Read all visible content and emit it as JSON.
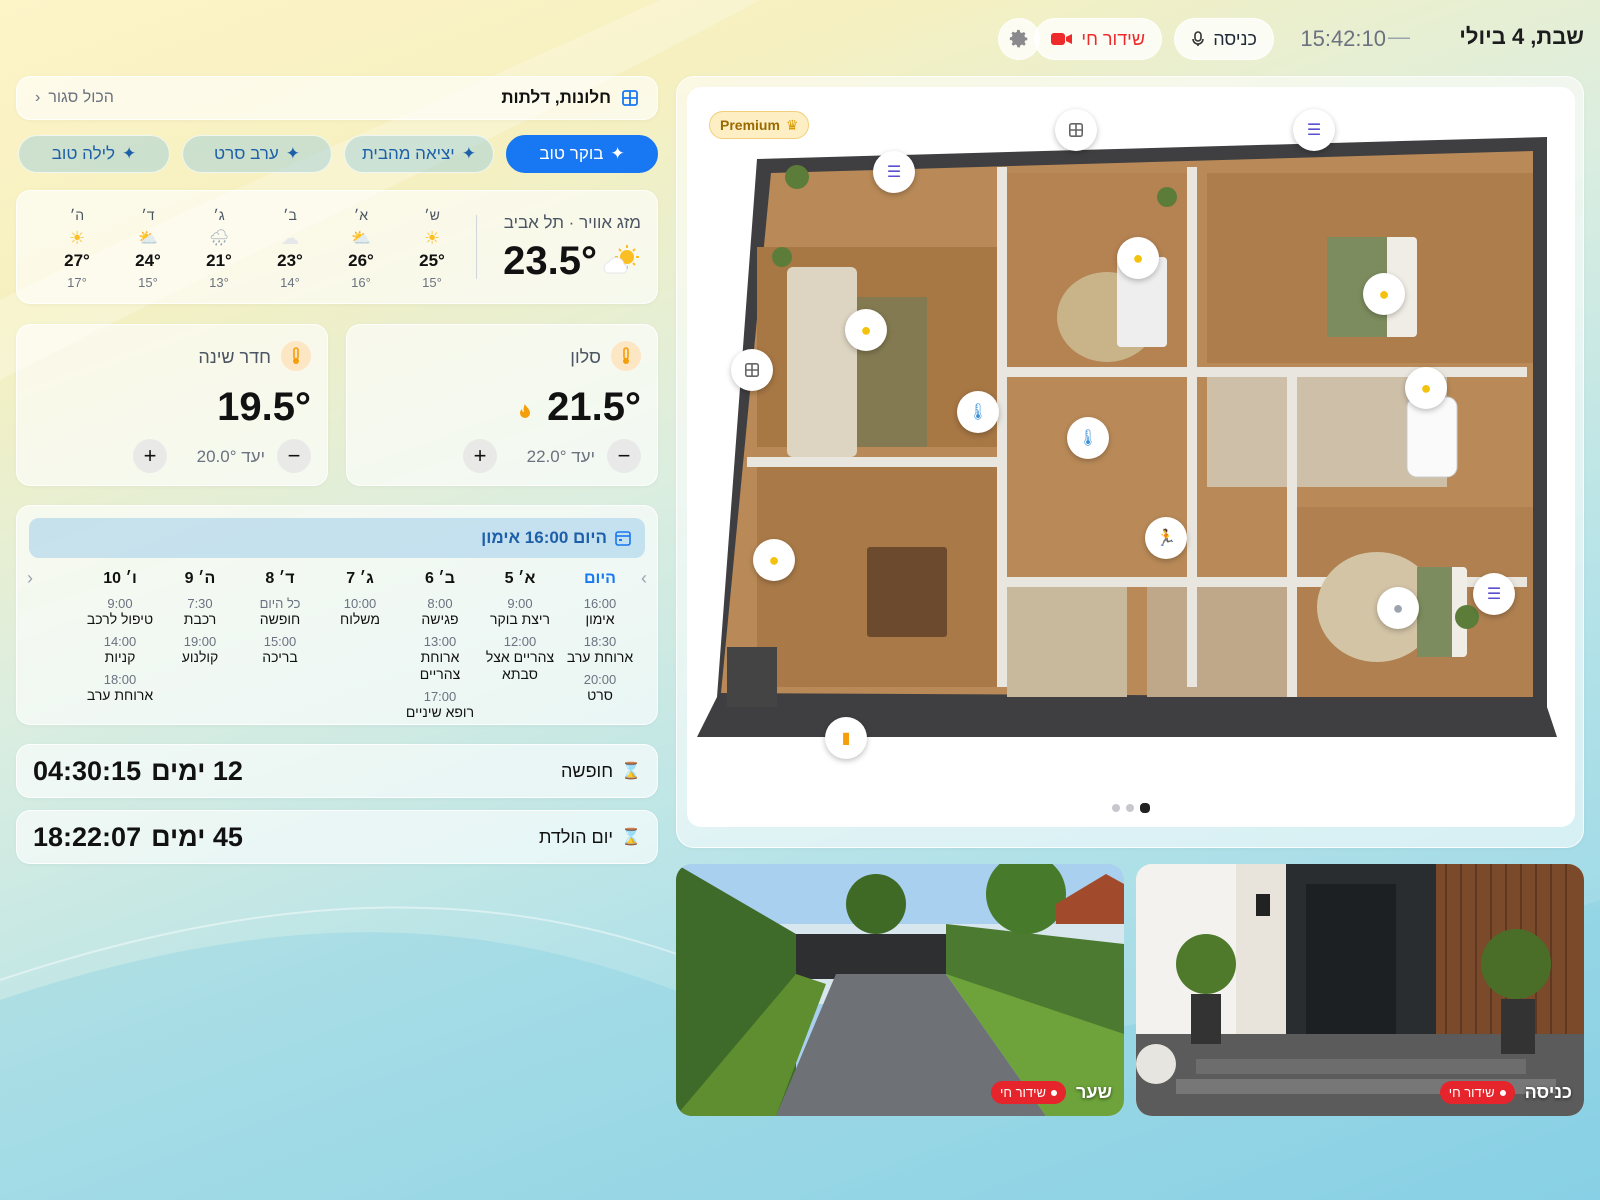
{
  "header": {
    "date": "שבת, 4 ביולי",
    "time": "15:42:10",
    "entrance_label": "כניסה",
    "live_label": "שידור חי"
  },
  "openings": {
    "title": "חלונות, דלתות",
    "status": "הכול סגור"
  },
  "scenes": [
    {
      "label": "בוקר טוב",
      "active": true
    },
    {
      "label": "יציאה מהבית",
      "active": false
    },
    {
      "label": "ערב סרט",
      "active": false
    },
    {
      "label": "לילה טוב",
      "active": false
    }
  ],
  "weather": {
    "title": "מזג אוויר · תל אביב",
    "current": "23.5°",
    "icon": "sun-cloud-icon",
    "forecast": [
      {
        "day": "ש׳",
        "icon": "sun-icon",
        "hi": "25°",
        "lo": "15°"
      },
      {
        "day": "א׳",
        "icon": "sun-cloud-icon",
        "hi": "26°",
        "lo": "16°"
      },
      {
        "day": "ב׳",
        "icon": "cloud-icon",
        "hi": "23°",
        "lo": "14°"
      },
      {
        "day": "ג׳",
        "icon": "rain-icon",
        "hi": "21°",
        "lo": "13°"
      },
      {
        "day": "ד׳",
        "icon": "sun-cloud-icon",
        "hi": "24°",
        "lo": "15°"
      },
      {
        "day": "ה׳",
        "icon": "sun-icon",
        "hi": "27°",
        "lo": "17°"
      }
    ]
  },
  "thermostats": [
    {
      "name": "סלון",
      "temp": "21.5°",
      "target": "יעד 22.0°",
      "heating": true
    },
    {
      "name": "חדר שינה",
      "temp": "19.5°",
      "target": "יעד 20.0°",
      "heating": false
    }
  ],
  "calendar": {
    "header": "היום 16:00 אימון",
    "days": [
      {
        "label": "היום",
        "today": true,
        "events": [
          {
            "time": "16:00",
            "name": "אימון"
          },
          {
            "time": "18:30",
            "name": "ארוחת ערב"
          },
          {
            "time": "20:00",
            "name": "סרט"
          }
        ]
      },
      {
        "label": "א׳ 5",
        "events": [
          {
            "time": "9:00",
            "name": "ריצת בוקר"
          },
          {
            "time": "12:00",
            "name": "צהריים אצל סבתא"
          }
        ]
      },
      {
        "label": "ב׳ 6",
        "events": [
          {
            "time": "8:00",
            "name": "פגישה"
          },
          {
            "time": "13:00",
            "name": "ארוחת צהריים"
          },
          {
            "time": "17:00",
            "name": "רופא שיניים"
          }
        ]
      },
      {
        "label": "ג׳ 7",
        "events": [
          {
            "time": "10:00",
            "name": "משלוח"
          }
        ]
      },
      {
        "label": "ד׳ 8",
        "events": [
          {
            "time": "כל היום",
            "name": "חופשה"
          },
          {
            "time": "15:00",
            "name": "בריכה"
          }
        ]
      },
      {
        "label": "ה׳ 9",
        "events": [
          {
            "time": "7:30",
            "name": "רכבת"
          },
          {
            "time": "19:00",
            "name": "קולנוע"
          }
        ]
      },
      {
        "label": "ו׳ 10",
        "events": [
          {
            "time": "9:00",
            "name": "טיפול לרכב"
          },
          {
            "time": "14:00",
            "name": "קניות"
          },
          {
            "time": "18:00",
            "name": "ארוחת ערב"
          }
        ]
      }
    ]
  },
  "countdowns": [
    {
      "label": "חופשה",
      "days": "12 ימים",
      "time": "04:30:15"
    },
    {
      "label": "יום הולדת",
      "days": "45 ימים",
      "time": "18:22:07"
    }
  ],
  "floorplan": {
    "badge": "Premium",
    "page_count": 3,
    "current_page": 3
  },
  "cameras": [
    {
      "name": "כניסה",
      "live": "שידור חי"
    },
    {
      "name": "שער",
      "live": "שידור חי"
    }
  ],
  "colors": {
    "accent": "#1877f2",
    "live": "#e5242b",
    "premium": "#fdefc3"
  }
}
